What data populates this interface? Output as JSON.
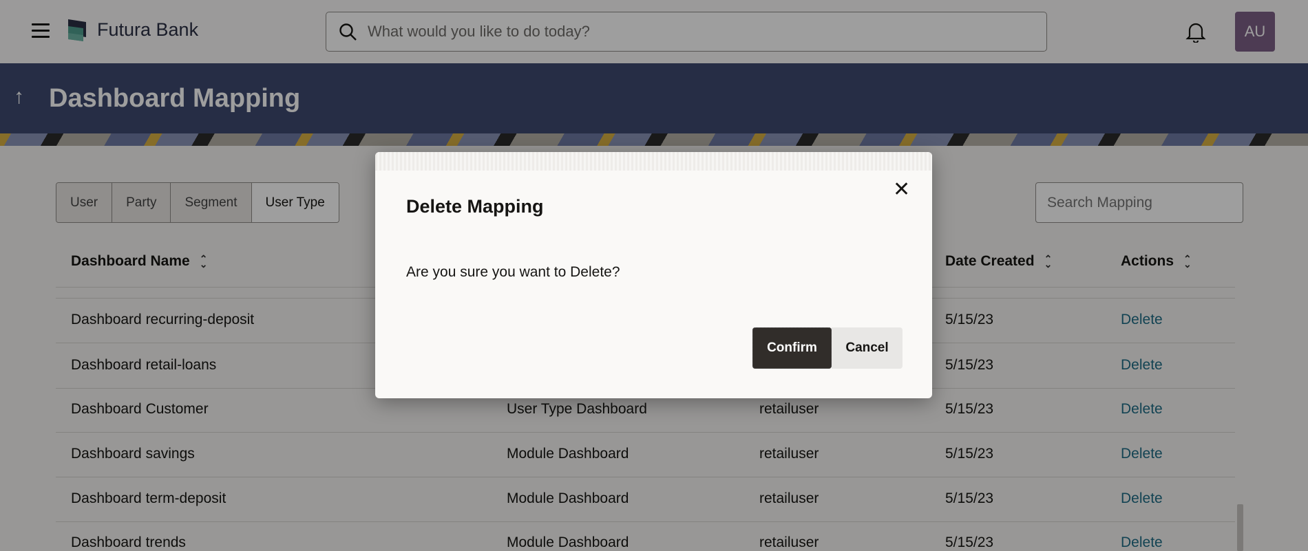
{
  "header": {
    "brand": "Futura Bank",
    "search_placeholder": "What would you like to do today?",
    "avatar_initials": "AU"
  },
  "page": {
    "title": "Dashboard Mapping"
  },
  "tabs": [
    "User",
    "Party",
    "Segment",
    "User Type"
  ],
  "selected_tab": "User Type",
  "search_mapping_placeholder": "Search Mapping",
  "table": {
    "headers": {
      "name": "Dashboard Name",
      "date": "Date Created",
      "actions": "Actions"
    },
    "rows": [
      {
        "name": "Dashboard recurring-deposit",
        "type": null,
        "user": null,
        "date": "5/15/23",
        "action": "Delete"
      },
      {
        "name": "Dashboard retail-loans",
        "type": null,
        "user": null,
        "date": "5/15/23",
        "action": "Delete"
      },
      {
        "name": "Dashboard Customer",
        "type": "User Type Dashboard",
        "user": "retailuser",
        "date": "5/15/23",
        "action": "Delete"
      },
      {
        "name": "Dashboard savings",
        "type": "Module Dashboard",
        "user": "retailuser",
        "date": "5/15/23",
        "action": "Delete"
      },
      {
        "name": "Dashboard term-deposit",
        "type": "Module Dashboard",
        "user": "retailuser",
        "date": "5/15/23",
        "action": "Delete"
      },
      {
        "name": "Dashboard trends",
        "type": "Module Dashboard",
        "user": "retailuser",
        "date": "5/15/23",
        "action": "Delete"
      }
    ]
  },
  "modal": {
    "title": "Delete Mapping",
    "message": "Are you sure you want to Delete?",
    "confirm": "Confirm",
    "cancel": "Cancel"
  },
  "colors": {
    "banner": "#3e4a70",
    "link": "#1f6d87",
    "primary_button": "#312d2a"
  }
}
